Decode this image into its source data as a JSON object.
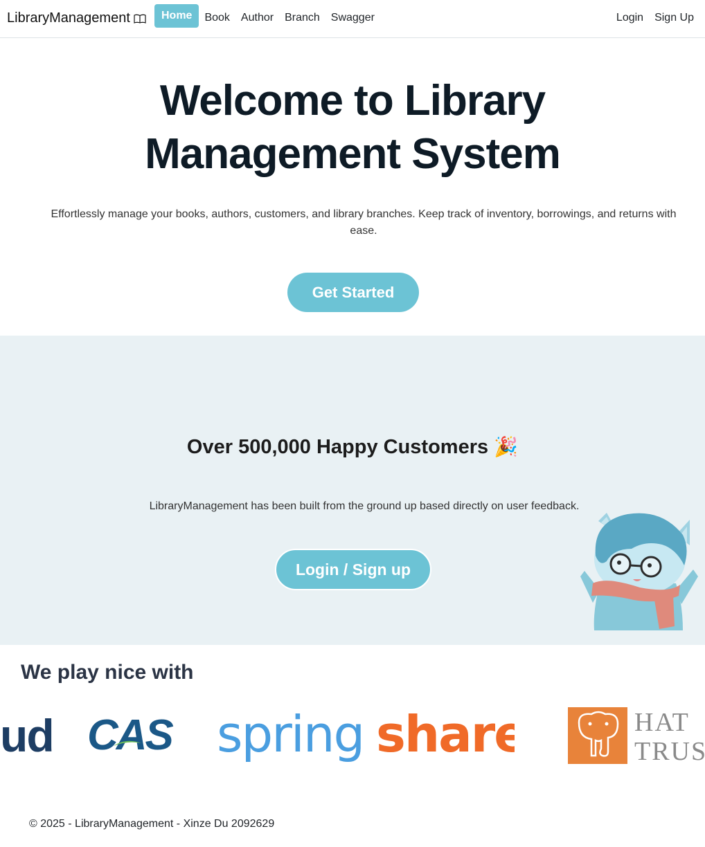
{
  "navbar": {
    "brand": "LibraryManagement",
    "brand_icon": "book-icon",
    "links": [
      {
        "label": "Home",
        "active": true
      },
      {
        "label": "Book"
      },
      {
        "label": "Author"
      },
      {
        "label": "Branch"
      },
      {
        "label": "Swagger"
      }
    ],
    "right_links": [
      {
        "label": "Login"
      },
      {
        "label": "Sign Up"
      }
    ]
  },
  "hero": {
    "title_line1": "Welcome to Library",
    "title_line2": "Management System",
    "subtitle": "Effortlessly manage your books, authors, customers, and library branches. Keep track of inventory, borrowings, and returns with ease.",
    "cta_label": "Get Started"
  },
  "customers": {
    "title": "Over 500,000 Happy Customers",
    "title_emoji": "🎉",
    "subtitle": "LibraryManagement has been built from the ground up based directly on user feedback.",
    "button_label": "Login / Sign up",
    "mascot": "mascot-illustration"
  },
  "partners": {
    "title": "We play nice with",
    "logos": [
      {
        "name": "ud-logo",
        "text": "ud"
      },
      {
        "name": "cas-logo",
        "text": "CAS"
      },
      {
        "name": "springshare-logo",
        "text_a": "spring",
        "text_b": "share"
      },
      {
        "name": "hathitrust-logo",
        "text_a": "HAT",
        "text_b": "TRUS"
      }
    ]
  },
  "footer": {
    "text": "© 2025 - LibraryManagement - Xinze Du 2092629"
  },
  "colors": {
    "accent": "#6cc3d5",
    "band_bg": "#e9f1f4",
    "springshare_blue": "#4a9ee0",
    "springshare_orange": "#f06a28",
    "hathi_orange": "#e8833a"
  }
}
